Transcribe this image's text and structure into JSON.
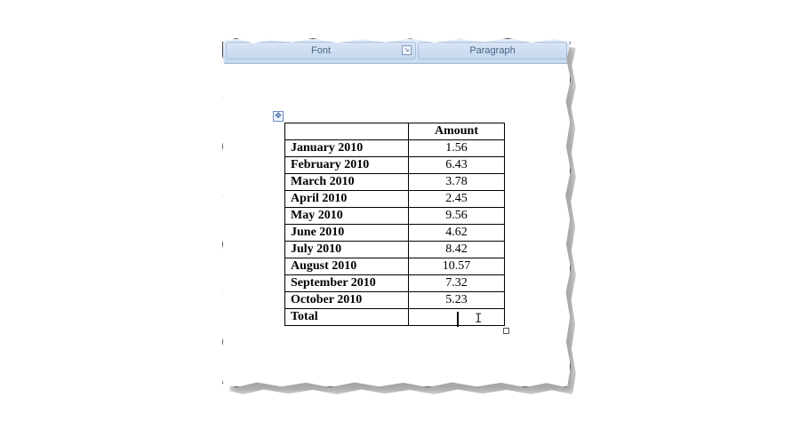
{
  "ribbon": {
    "font_group_label": "Font",
    "paragraph_group_label": "Paragraph",
    "launcher_icon": "dialog-launcher-icon"
  },
  "table": {
    "headers": [
      "",
      "Amount"
    ],
    "rows": [
      {
        "month": "January 2010",
        "amount": "1.56"
      },
      {
        "month": "February 2010",
        "amount": "6.43"
      },
      {
        "month": "March 2010",
        "amount": "3.78"
      },
      {
        "month": "April 2010",
        "amount": "2.45"
      },
      {
        "month": "May 2010",
        "amount": "9.56"
      },
      {
        "month": "June 2010",
        "amount": "4.62"
      },
      {
        "month": "July 2010",
        "amount": "8.42"
      },
      {
        "month": "August 2010",
        "amount": "10.57"
      },
      {
        "month": "September 2010",
        "amount": "7.32"
      },
      {
        "month": "October 2010",
        "amount": "5.23"
      }
    ],
    "total_label": "Total",
    "total_value": ""
  },
  "icons": {
    "move_handle": "✥",
    "cursor": "I"
  },
  "colors": {
    "ribbon_bg": "#c9daf0",
    "ribbon_text": "#4a6285",
    "table_border": "#000000"
  }
}
